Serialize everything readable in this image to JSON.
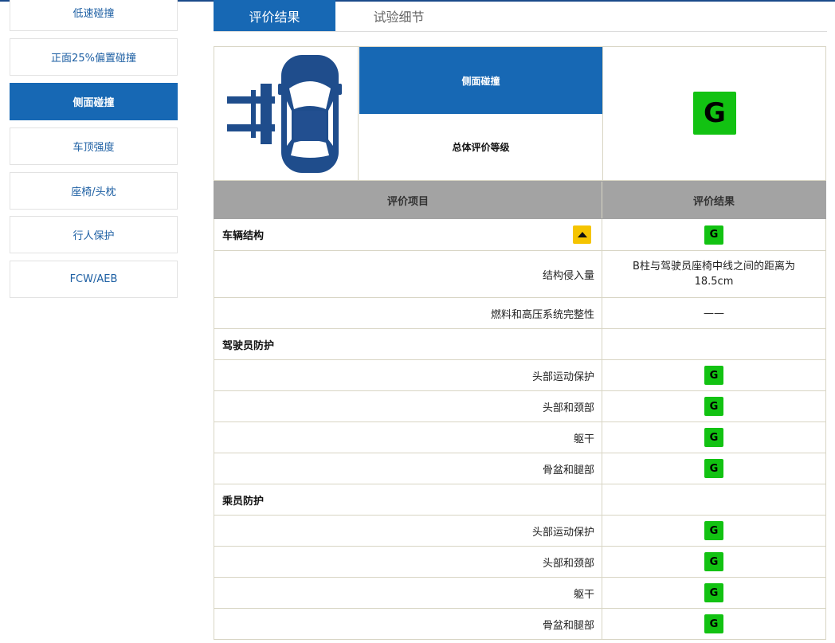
{
  "sidebar": {
    "items": [
      {
        "label": "低速碰撞",
        "active": false
      },
      {
        "label": "正面25%偏置碰撞",
        "active": false
      },
      {
        "label": "侧面碰撞",
        "active": true
      },
      {
        "label": "车顶强度",
        "active": false
      },
      {
        "label": "座椅/头枕",
        "active": false
      },
      {
        "label": "行人保护",
        "active": false
      },
      {
        "label": "FCW/AEB",
        "active": false
      }
    ]
  },
  "tabs": [
    {
      "label": "评价结果",
      "active": true
    },
    {
      "label": "试验细节",
      "active": false
    }
  ],
  "summary": {
    "icon": "side-impact-car-icon",
    "category": "侧面碰撞",
    "overall_label": "总体评价等级",
    "overall_grade": "G"
  },
  "table": {
    "headers": {
      "item": "评价项目",
      "result": "评价结果"
    },
    "rows": [
      {
        "type": "group",
        "label": "车辆结构",
        "grade": "G",
        "collapsible": true
      },
      {
        "type": "sub",
        "label": "结构侵入量",
        "text": "B柱与驾驶员座椅中线之间的距离为18.5cm"
      },
      {
        "type": "sub",
        "label": "燃料和高压系统完整性",
        "text": "——"
      },
      {
        "type": "group",
        "label": "驾驶员防护"
      },
      {
        "type": "sub",
        "label": "头部运动保护",
        "grade": "G"
      },
      {
        "type": "sub",
        "label": "头部和颈部",
        "grade": "G"
      },
      {
        "type": "sub",
        "label": "躯干",
        "grade": "G"
      },
      {
        "type": "sub",
        "label": "骨盆和腿部",
        "grade": "G"
      },
      {
        "type": "group",
        "label": "乘员防护"
      },
      {
        "type": "sub",
        "label": "头部运动保护",
        "grade": "G"
      },
      {
        "type": "sub",
        "label": "头部和颈部",
        "grade": "G"
      },
      {
        "type": "sub",
        "label": "躯干",
        "grade": "G"
      },
      {
        "type": "sub",
        "label": "骨盆和腿部",
        "grade": "G"
      }
    ]
  },
  "colors": {
    "brand_blue": "#1768b4",
    "grade_good": "#12c212",
    "collapse_yellow": "#f5c400",
    "header_gray": "#a3a3a3"
  }
}
